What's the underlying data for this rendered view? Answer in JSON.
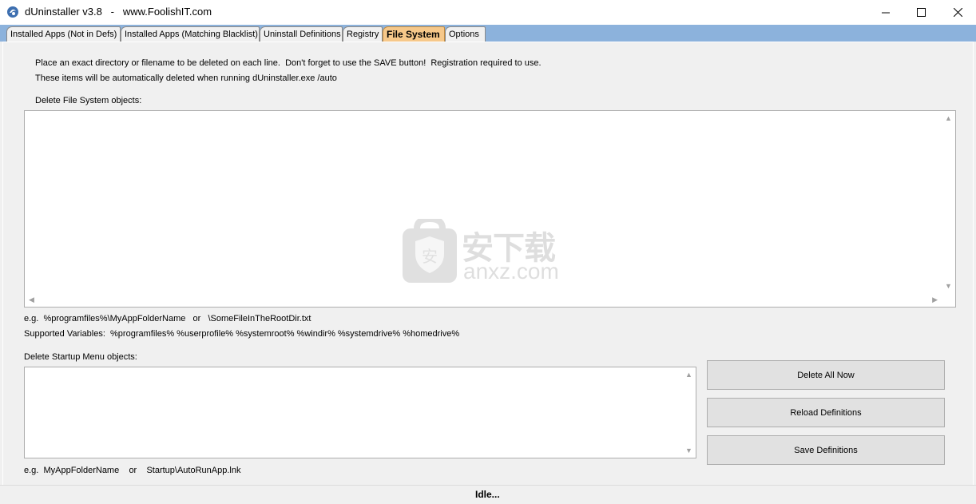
{
  "window": {
    "title": "dUninstaller v3.8   -   www.FoolishIT.com"
  },
  "tabs": [
    {
      "label": "Installed Apps (Not in Defs)",
      "active": false
    },
    {
      "label": "Installed Apps (Matching Blacklist)",
      "active": false
    },
    {
      "label": "Uninstall Definitions",
      "active": false
    },
    {
      "label": "Registry",
      "active": false
    },
    {
      "label": "File System",
      "active": true
    },
    {
      "label": "Options",
      "active": false
    }
  ],
  "file_system": {
    "intro_line1": "Place an exact directory or filename to be deleted on each line.  Don't forget to use the SAVE button!  Registration required to use.",
    "intro_line2": "These items will be automatically deleted when running dUninstaller.exe /auto",
    "fs_objects_label": "Delete File System objects:",
    "fs_objects_value": "",
    "fs_example": "e.g.  %programfiles%\\MyAppFolderName   or   \\SomeFileInTheRootDir.txt",
    "supported_vars": "Supported Variables:  %programfiles% %userprofile% %systemroot% %windir% %systemdrive% %homedrive%",
    "startup_label": "Delete Startup Menu objects:",
    "startup_value": "",
    "startup_example": "e.g.  MyAppFolderName    or    Startup\\AutoRunApp.lnk"
  },
  "buttons": {
    "delete_all": "Delete All Now",
    "reload": "Reload Definitions",
    "save": "Save Definitions"
  },
  "watermark": {
    "cn": "安下载",
    "en": "anxz.com",
    "badge": "安"
  },
  "status": {
    "text": "Idle..."
  },
  "colors": {
    "tabstrip": "#8cb2dc",
    "active_tab": "#f6c88a"
  }
}
